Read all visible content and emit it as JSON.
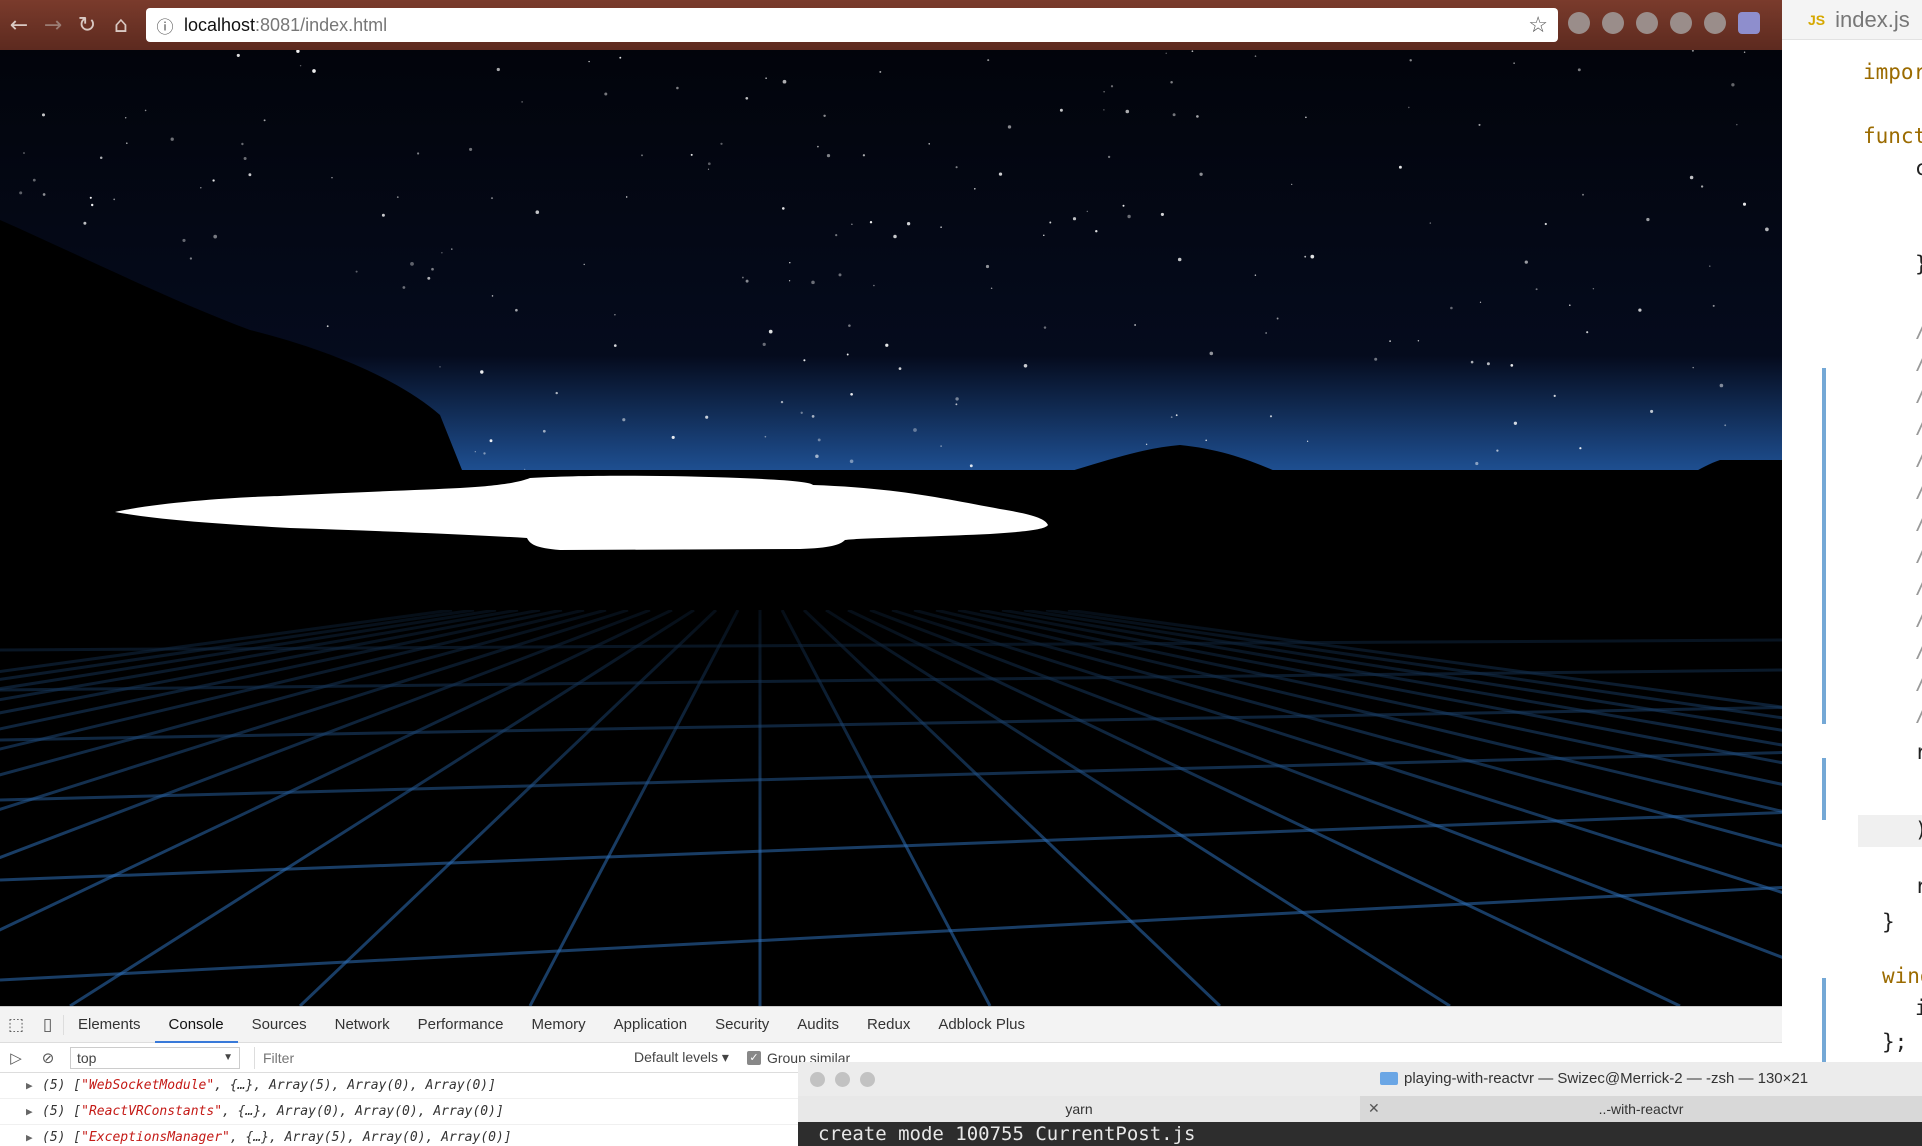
{
  "browser": {
    "url_host": "localhost",
    "url_rest": ":8081/index.html",
    "nav": {
      "back": "←",
      "forward": "→",
      "reload": "↻",
      "home": "⌂"
    },
    "icons": [
      "back-arrow-icon",
      "forward-arrow-icon",
      "reload-icon",
      "home-icon",
      "info-icon",
      "bookmark-star-icon"
    ]
  },
  "scene": {
    "description_icons": [
      "starfield",
      "mountain-silhouette",
      "grid-floor",
      "spaceship-silhouette"
    ],
    "colors": {
      "sky_top": "#02040b",
      "sky_horizon": "#1e4f91",
      "ground": "#000000",
      "grid": "#2e6fb8"
    }
  },
  "devtools": {
    "tabs": [
      "Elements",
      "Console",
      "Sources",
      "Network",
      "Performance",
      "Memory",
      "Application",
      "Security",
      "Audits",
      "Redux",
      "Adblock Plus"
    ],
    "active_tab": "Console",
    "context": "top",
    "filter_placeholder": "Filter",
    "levels": "Default levels",
    "group_similar": "Group similar",
    "log": [
      {
        "count": "(5)",
        "module": "\"WebSocketModule\"",
        "rest": ", {…}, Array(5), Array(0), Array(0)]"
      },
      {
        "count": "(5)",
        "module": "\"ReactVRConstants\"",
        "rest": ", {…}, Array(0), Array(0), Array(0)]"
      },
      {
        "count": "(5)",
        "module": "\"ExceptionsManager\"",
        "rest": ", {…}, Array(5), Array(0), Array(0)]"
      }
    ]
  },
  "terminal": {
    "title": "playing-with-reactvr — Swizec@Merrick-2 — -zsh — 130×21",
    "tabs": [
      "yarn",
      "..-with-reactvr"
    ],
    "output": "create mode 100755 CurrentPost.js"
  },
  "editor": {
    "badge": "JS",
    "filename": "index.js",
    "lines": [
      {
        "text": "impor",
        "cls": "kw"
      },
      {
        "text": "funct",
        "cls": "kw"
      },
      {
        "text": "c",
        "cls": ""
      },
      {
        "text": "}",
        "cls": ""
      },
      {
        "text": "/",
        "cls": "cm"
      },
      {
        "text": "/",
        "cls": "cm"
      },
      {
        "text": "/",
        "cls": "cm"
      },
      {
        "text": "/",
        "cls": "cm"
      },
      {
        "text": "/",
        "cls": "cm"
      },
      {
        "text": "/",
        "cls": "cm"
      },
      {
        "text": "/",
        "cls": "cm"
      },
      {
        "text": "/",
        "cls": "cm"
      },
      {
        "text": "/",
        "cls": "cm"
      },
      {
        "text": "/",
        "cls": "cm"
      },
      {
        "text": "/",
        "cls": "cm"
      },
      {
        "text": "/",
        "cls": "cm"
      },
      {
        "text": "/",
        "cls": "cm"
      },
      {
        "text": "r",
        "cls": ""
      },
      {
        "text": ")",
        "cls": ""
      },
      {
        "text": "r",
        "cls": ""
      },
      {
        "text": "}",
        "cls": ""
      },
      {
        "text": "windo",
        "cls": "kw"
      },
      {
        "text": "i",
        "cls": ""
      },
      {
        "text": "};",
        "cls": ""
      }
    ]
  }
}
